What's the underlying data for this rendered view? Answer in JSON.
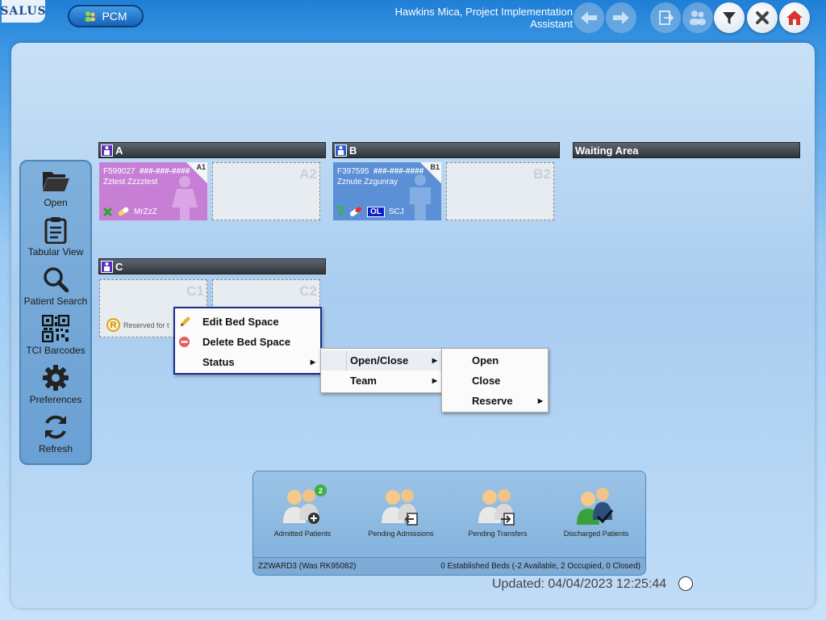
{
  "header": {
    "logo_text": "SALUS",
    "module_label": "PCM",
    "user": "Hawkins Mica, Project Implementation Assistant",
    "nav_icons": [
      "back-arrow-icon",
      "forward-arrow-icon",
      "logout-icon",
      "people-icon",
      "filter-icon",
      "close-icon",
      "home-icon"
    ]
  },
  "sidebar": {
    "items": [
      {
        "label": "Open",
        "icon": "folder-open-icon"
      },
      {
        "label": "Tabular View",
        "icon": "clipboard-icon"
      },
      {
        "label": "Patient Search",
        "icon": "magnifier-icon"
      },
      {
        "label": "TCI Barcodes",
        "icon": "qr-code-icon"
      },
      {
        "label": "Preferences",
        "icon": "gear-icon"
      },
      {
        "label": "Refresh",
        "icon": "refresh-icon"
      }
    ]
  },
  "bays": [
    {
      "name": "A",
      "beds": [
        {
          "label": "A1",
          "number": "F599027",
          "nhs": "###-###-####",
          "patient": "Zztest Zzzztest",
          "flag": "MrZzZ",
          "status": "occupied",
          "icon": "female-icon",
          "color": "#c77fd6"
        },
        {
          "label": "A2",
          "status": "empty"
        }
      ]
    },
    {
      "name": "B",
      "beds": [
        {
          "label": "B1",
          "number": "F397595",
          "nhs": "###-###-####",
          "patient": "Zznute Zzgunray",
          "badge": "OL",
          "flag": "SCJ",
          "status": "occupied",
          "icon": "male-icon",
          "color": "#5b8fd6"
        },
        {
          "label": "B2",
          "status": "empty"
        }
      ]
    },
    {
      "name": "Waiting Area",
      "beds": []
    },
    {
      "name": "C",
      "beds": [
        {
          "label": "C1",
          "status": "reserved",
          "reserved_text": "Reserved for t"
        },
        {
          "label": "C2",
          "status": "empty"
        }
      ]
    }
  ],
  "context_menu": {
    "items": [
      {
        "label": "Edit Bed Space",
        "icon": "pencil-icon"
      },
      {
        "label": "Delete Bed Space",
        "icon": "delete-circle-icon"
      },
      {
        "label": "Status",
        "submenu": true
      }
    ],
    "status_submenu": [
      {
        "label": "Open/Close",
        "submenu": true
      },
      {
        "label": "Team",
        "submenu": true
      }
    ],
    "open_close_submenu": [
      {
        "label": "Open"
      },
      {
        "label": "Close"
      },
      {
        "label": "Reserve",
        "submenu": true
      }
    ]
  },
  "bottom_panel": {
    "items": [
      {
        "label": "Admitted Patients",
        "badge": "2"
      },
      {
        "label": "Pending Admissions"
      },
      {
        "label": "Pending Transfers"
      },
      {
        "label": "Discharged Patients"
      }
    ],
    "ward": "ZZWARD3 (Was RK95082)",
    "summary": "0 Established Beds (-2 Available, 2 Occupied, 0 Closed)"
  },
  "updated": "Updated: 04/04/2023 12:25:44"
}
